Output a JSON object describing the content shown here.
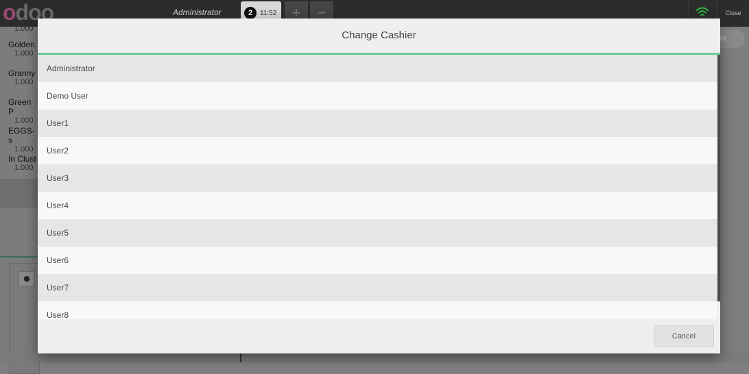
{
  "topbar": {
    "logo_text": "odoo",
    "cashier": "Administrator",
    "order_tab": {
      "number": "2",
      "time": "11:52"
    },
    "add_order_label": "+",
    "remove_order_label": "−",
    "close_label": "Close",
    "wifi_color": "#2eae42"
  },
  "background": {
    "order_lines": [
      {
        "name": "Golden",
        "qty": "1.000"
      },
      {
        "name": "Granny",
        "qty": "1.000"
      },
      {
        "name": "Green P",
        "qty": "1.000"
      },
      {
        "name": "EGGS-s",
        "qty": "1.000"
      },
      {
        "name": "In Clust",
        "qty": "1.000"
      }
    ],
    "top_qty": "1.000",
    "products_button": "cts"
  },
  "modal": {
    "title": "Change Cashier",
    "accent_color": "#6ec89b",
    "users": [
      "Administrator",
      "Demo User",
      "User1",
      "User2",
      "User3",
      "User4",
      "User5",
      "User6",
      "User7",
      "User8"
    ],
    "cancel_label": "Cancel"
  }
}
